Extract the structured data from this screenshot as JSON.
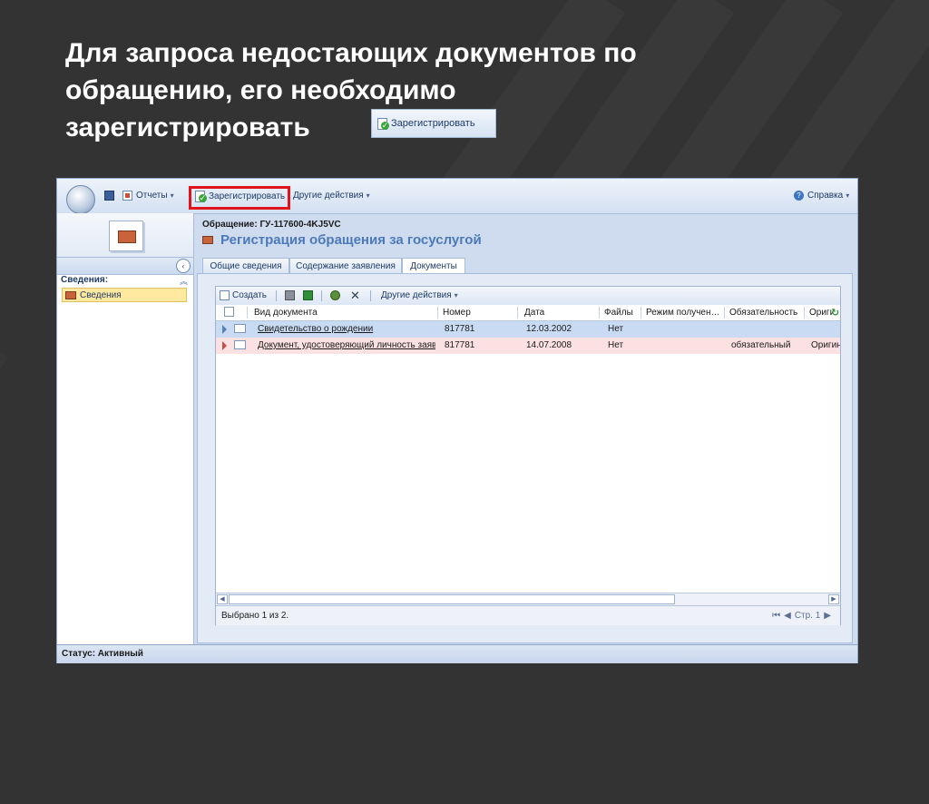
{
  "slide": {
    "title_lines": [
      "Для запроса недостающих документов по",
      "обращению, его необходимо",
      "зарегистрировать"
    ],
    "inline_button_label": "Зарегистрировать"
  },
  "toolbar": {
    "reports_label": "Отчеты",
    "register_label": "Зарегистрировать",
    "other_actions_label": "Другие действия",
    "help_label": "Справка"
  },
  "nav": {
    "section_title": "Сведения:",
    "items": [
      {
        "label": "Сведения"
      }
    ]
  },
  "record": {
    "label": "Обращение: ГУ-117600-4KJ5VC",
    "title": "Регистрация обращения за госуслугой"
  },
  "tabs": [
    {
      "label": "Общие сведения"
    },
    {
      "label": "Содержание заявления"
    },
    {
      "label": "Документы"
    }
  ],
  "grid": {
    "toolbar": {
      "create_label": "Создать",
      "other_actions_label": "Другие действия"
    },
    "columns": [
      "Вид документа",
      "Номер",
      "Дата",
      "Файлы",
      "Режим получен…",
      "Обязательность",
      "Ориги"
    ],
    "rows": [
      {
        "doc_type": "Свидетельство о рождении",
        "number": "817781",
        "date": "12.03.2002",
        "files": "Нет",
        "mode": "",
        "required": "",
        "original": ""
      },
      {
        "doc_type": "Документ, удостоверяющий личность заяв",
        "number": "817781",
        "date": "14.07.2008",
        "files": "Нет",
        "mode": "",
        "required": "обязательный",
        "original": "Оригин"
      }
    ],
    "footer": {
      "selected_text": "Выбрано 1 из 2.",
      "page_text": "Стр. 1"
    }
  },
  "status": {
    "text": "Статус: Активный"
  },
  "colors": {
    "accent_title": "#4c7ab8",
    "highlight_border": "#e0141c",
    "selected_row": "#c9dbf2",
    "required_row": "#fbe1e1"
  }
}
